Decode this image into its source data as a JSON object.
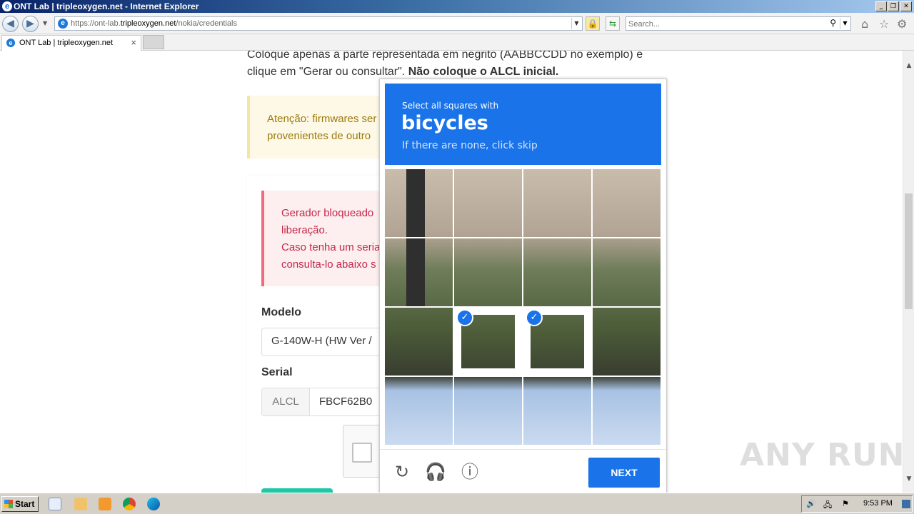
{
  "window": {
    "title": "ONT Lab | tripleoxygen.net - Internet Explorer",
    "buttons": [
      "_",
      "❐",
      "✕"
    ]
  },
  "address_bar": {
    "url_prefix": "https://ont-lab.",
    "url_domain": "tripleoxygen.net",
    "url_path": "/nokia/credentials"
  },
  "search_bar": {
    "placeholder": "Search..."
  },
  "tab": {
    "label": "ONT Lab | tripleoxygen.net"
  },
  "page": {
    "intro_text": "Coloque apenas a parte representada em negrito (AABBCCDD no exemplo) e clique em \"Gerar ou consultar\".",
    "intro_bold": "Não coloque o ALCL inicial.",
    "warning_line1": "Atenção: firmwares ser",
    "warning_line2": "provenientes de outro",
    "danger_line1": "Gerador bloqueado",
    "danger_line2": "liberação.",
    "danger_line3": "Caso tenha um seria",
    "danger_line4": "consulta-lo abaixo s",
    "modelo_label": "Modelo",
    "modelo_value": "G-140W-H (HW Ver /",
    "serial_label": "Serial",
    "serial_prefix": "ALCL",
    "serial_value": "FBCF62B0"
  },
  "captcha": {
    "instruction": "Select all squares with",
    "target": "bicycles",
    "hint": "If there are none, click skip",
    "selected_tiles": [
      9,
      10
    ],
    "next_label": "NEXT"
  },
  "watermark": "ANY RUN",
  "taskbar": {
    "start_label": "Start",
    "clock": "9:53 PM"
  },
  "colors": {
    "captcha_blue": "#1a73e8",
    "warning_text": "#9b7a0c",
    "danger_text": "#c4294a"
  }
}
